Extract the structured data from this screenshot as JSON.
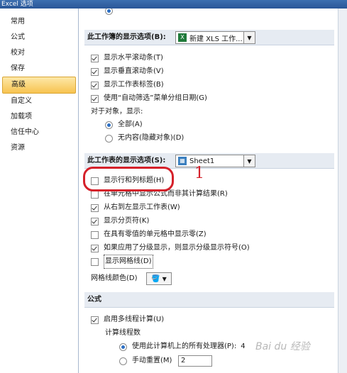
{
  "window": {
    "title": "Excel 选项"
  },
  "nav": {
    "items": [
      {
        "label": "常用",
        "active": false
      },
      {
        "label": "公式",
        "active": false
      },
      {
        "label": "校对",
        "active": false
      },
      {
        "label": "保存",
        "active": false
      },
      {
        "label": "高级",
        "active": true
      },
      {
        "label": "自定义",
        "active": false
      },
      {
        "label": "加载项",
        "active": false
      },
      {
        "label": "信任中心",
        "active": false
      },
      {
        "label": "资源",
        "active": false
      }
    ]
  },
  "workbook": {
    "header": "此工作簿的显示选项(B):",
    "combo": "新建 XLS 工作...",
    "options": [
      {
        "label": "显示水平滚动条(T)",
        "checked": true
      },
      {
        "label": "显示垂直滚动条(V)",
        "checked": true
      },
      {
        "label": "显示工作表标签(B)",
        "checked": true
      },
      {
        "label": "使用“自动筛选”菜单分组日期(G)",
        "checked": true
      }
    ],
    "objects_label": "对于对象，显示:",
    "radios": [
      {
        "label": "全部(A)",
        "checked": true
      },
      {
        "label": "无内容(隐藏对象)(D)",
        "checked": false
      }
    ]
  },
  "worksheet": {
    "header": "此工作表的显示选项(S):",
    "combo": "Sheet1",
    "options": [
      {
        "label": "显示行和列标题(H)",
        "checked": false
      },
      {
        "label": "在单元格中显示公式而非其计算结果(R)",
        "checked": false
      },
      {
        "label": "从右到左显示工作表(W)",
        "checked": true
      },
      {
        "label": "显示分页符(K)",
        "checked": true
      },
      {
        "label": "在具有零值的单元格中显示零(Z)",
        "checked": false
      },
      {
        "label": "如果应用了分级显示，则显示分级显示符号(O)",
        "checked": true
      },
      {
        "label": "显示网格线(D)",
        "checked": false
      }
    ],
    "gridline_color_label": "网格线颜色(D)"
  },
  "formula": {
    "header": "公式",
    "multithread": {
      "label": "启用多线程计算(U)",
      "checked": true
    },
    "threads_label": "计算线程数",
    "use_all": {
      "label": "使用此计算机上的所有处理器(P):",
      "value": "4",
      "checked": true
    },
    "manual": {
      "label": "手动重置(M)",
      "value": "2",
      "checked": false
    }
  },
  "annotation": {
    "number": "1"
  },
  "watermark": "Bai du 经验"
}
